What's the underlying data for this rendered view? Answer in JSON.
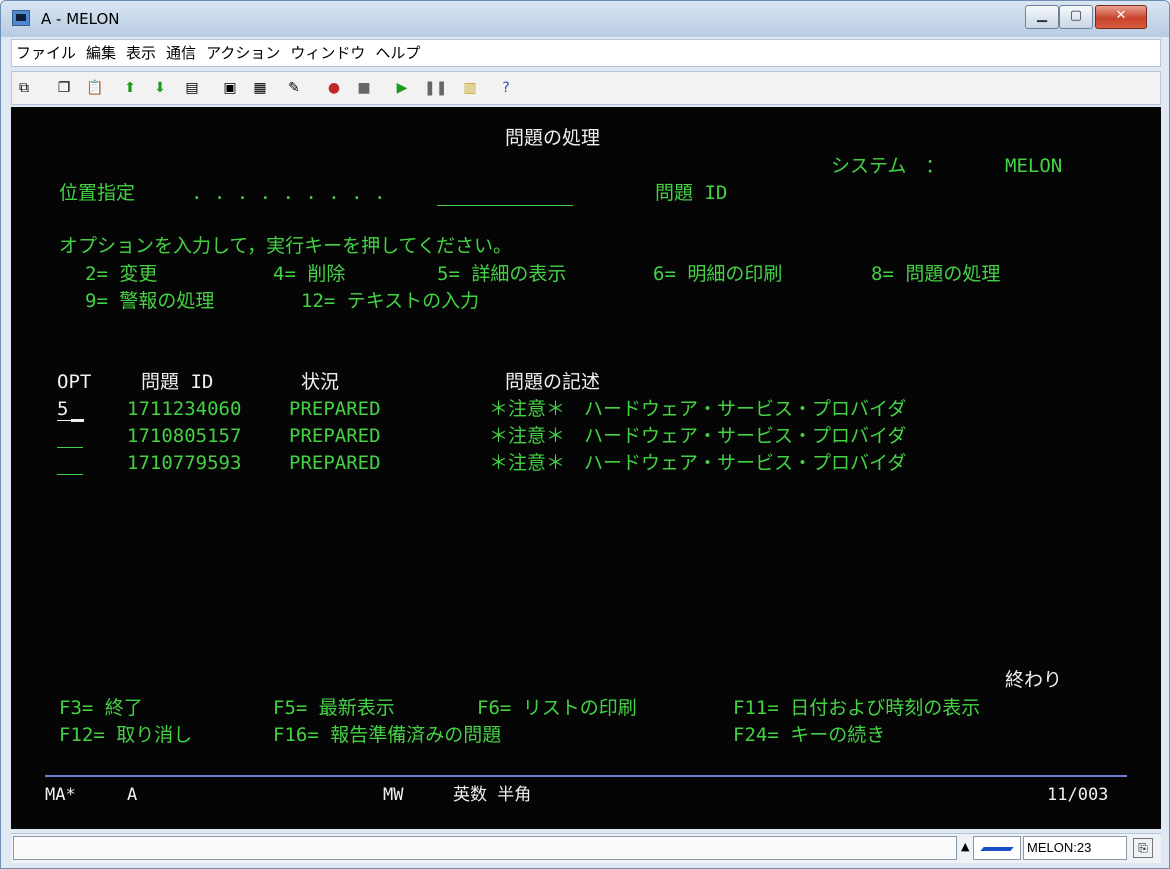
{
  "window": {
    "title": "A - MELON"
  },
  "menu": [
    "ファイル",
    "編集",
    "表示",
    "通信",
    "アクション",
    "ウィンドウ",
    "ヘルプ"
  ],
  "toolbar_icons": [
    "copy-icon",
    "paste-icon",
    "clipboard-icon",
    "send-upload-icon",
    "receive-download-icon",
    "document-icon",
    "display-icon",
    "grid-icon",
    "macro-icon",
    "record-icon",
    "stop-icon",
    "play-icon",
    "pause-icon",
    "notes-icon",
    "help-icon"
  ],
  "screen": {
    "title": "問題の処理",
    "system_label": "システム　：",
    "system_value": "MELON",
    "position_label": "位置指定",
    "position_dots": ". . . . . . . . .",
    "position_field_label": "問題 ID",
    "instruction": "オプションを入力して，実行キーを押してください。",
    "options_line1": [
      "2= 変更",
      "4= 削除",
      "5= 詳細の表示",
      "6= 明細の印刷",
      "8= 問題の処理"
    ],
    "options_line2": [
      "9= 警報の処理",
      "12= テキストの入力"
    ],
    "columns": {
      "opt": "OPT",
      "problem_id": "問題 ID",
      "status": "状況",
      "description": "問題の記述"
    },
    "rows": [
      {
        "opt": "5",
        "problem_id": "1711234060",
        "status": "PREPARED",
        "description": "＊注意＊　ハードウェア・サービス・プロバイダ"
      },
      {
        "opt": "",
        "problem_id": "1710805157",
        "status": "PREPARED",
        "description": "＊注意＊　ハードウェア・サービス・プロバイダ"
      },
      {
        "opt": "",
        "problem_id": "1710779593",
        "status": "PREPARED",
        "description": "＊注意＊　ハードウェア・サービス・プロバイダ"
      }
    ],
    "more_indicator": "終わり",
    "fkeys_line1": [
      "F3= 終了",
      "F5= 最新表示",
      "F6= リストの印刷",
      "F11= 日付および時刻の表示"
    ],
    "fkeys_line2": [
      "F12= 取り消し",
      "F16= 報告準備済みの問題",
      "F24= キーの続き"
    ],
    "oia": {
      "left": "MA*",
      "session": "A",
      "mw": "MW",
      "mode": "英数 半角",
      "cursor_pos": "11/003"
    }
  },
  "statusbar": {
    "session_name": "MELON:23"
  }
}
